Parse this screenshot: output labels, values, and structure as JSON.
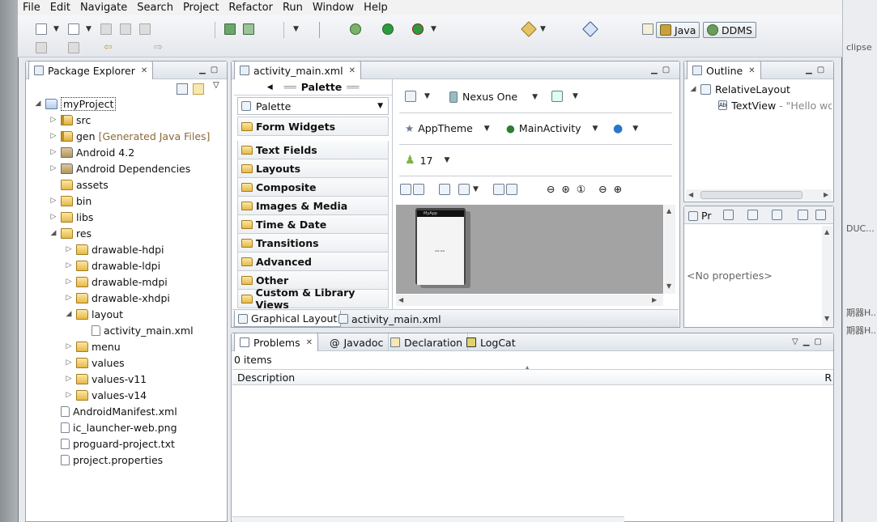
{
  "menu": [
    "File",
    "Edit",
    "Navigate",
    "Search",
    "Project",
    "Refactor",
    "Run",
    "Window",
    "Help"
  ],
  "perspectives": {
    "java": "Java",
    "ddms": "DDMS"
  },
  "right_strip": {
    "t1": "clipse",
    "t2": "DUC...",
    "t3": "期器H...",
    "t4": "期器H..."
  },
  "package_explorer": {
    "title": "Package Explorer",
    "items": [
      {
        "label": "myProject",
        "depth": 0,
        "twisty": "▲",
        "icon": "project"
      },
      {
        "label": "src",
        "depth": 1,
        "twisty": "▷",
        "icon": "package"
      },
      {
        "label": "gen",
        "extra": "[Generated Java Files]",
        "depth": 1,
        "twisty": "▷",
        "icon": "package"
      },
      {
        "label": "Android 4.2",
        "depth": 1,
        "twisty": "▷",
        "icon": "library"
      },
      {
        "label": "Android Dependencies",
        "depth": 1,
        "twisty": "▷",
        "icon": "library"
      },
      {
        "label": "assets",
        "depth": 1,
        "twisty": "",
        "icon": "folder"
      },
      {
        "label": "bin",
        "depth": 1,
        "twisty": "▷",
        "icon": "folder"
      },
      {
        "label": "libs",
        "depth": 1,
        "twisty": "▷",
        "icon": "folder"
      },
      {
        "label": "res",
        "depth": 1,
        "twisty": "◢",
        "icon": "folder"
      },
      {
        "label": "drawable-hdpi",
        "depth": 2,
        "twisty": "▷",
        "icon": "folder"
      },
      {
        "label": "drawable-ldpi",
        "depth": 2,
        "twisty": "▷",
        "icon": "folder"
      },
      {
        "label": "drawable-mdpi",
        "depth": 2,
        "twisty": "▷",
        "icon": "folder"
      },
      {
        "label": "drawable-xhdpi",
        "depth": 2,
        "twisty": "▷",
        "icon": "folder"
      },
      {
        "label": "layout",
        "depth": 2,
        "twisty": "◢",
        "icon": "folder"
      },
      {
        "label": "activity_main.xml",
        "depth": 3,
        "twisty": "",
        "icon": "file"
      },
      {
        "label": "menu",
        "depth": 2,
        "twisty": "▷",
        "icon": "folder"
      },
      {
        "label": "values",
        "depth": 2,
        "twisty": "▷",
        "icon": "folder"
      },
      {
        "label": "values-v11",
        "depth": 2,
        "twisty": "▷",
        "icon": "folder"
      },
      {
        "label": "values-v14",
        "depth": 2,
        "twisty": "▷",
        "icon": "folder"
      },
      {
        "label": "AndroidManifest.xml",
        "depth": 1,
        "twisty": "",
        "icon": "file"
      },
      {
        "label": "ic_launcher-web.png",
        "depth": 1,
        "twisty": "",
        "icon": "file"
      },
      {
        "label": "proguard-project.txt",
        "depth": 1,
        "twisty": "",
        "icon": "file"
      },
      {
        "label": "project.properties",
        "depth": 1,
        "twisty": "",
        "icon": "file"
      }
    ]
  },
  "editor": {
    "tab": "activity_main.xml",
    "palette_title": "Palette",
    "palette_dropdown": "Palette",
    "categories": [
      "Form Widgets",
      "Text Fields",
      "Layouts",
      "Composite",
      "Images & Media",
      "Time & Date",
      "Transitions",
      "Advanced",
      "Other",
      "Custom & Library Views"
    ],
    "device": "Nexus One",
    "theme": "AppTheme",
    "activity": "MainActivity",
    "api": "17",
    "phone_title": "MyApp",
    "bottom_tabs": {
      "graphical": "Graphical Layout",
      "xml": "activity_main.xml"
    }
  },
  "outline": {
    "title": "Outline",
    "root": "RelativeLayout",
    "child": "TextView",
    "child_value": "- \"Hello wo"
  },
  "properties": {
    "tab": "Pr",
    "empty": "<No properties>"
  },
  "problems": {
    "tabs": [
      "Problems",
      "Javadoc",
      "Declaration",
      "LogCat"
    ],
    "count": "0 items",
    "column": "Description",
    "column2": "R"
  }
}
